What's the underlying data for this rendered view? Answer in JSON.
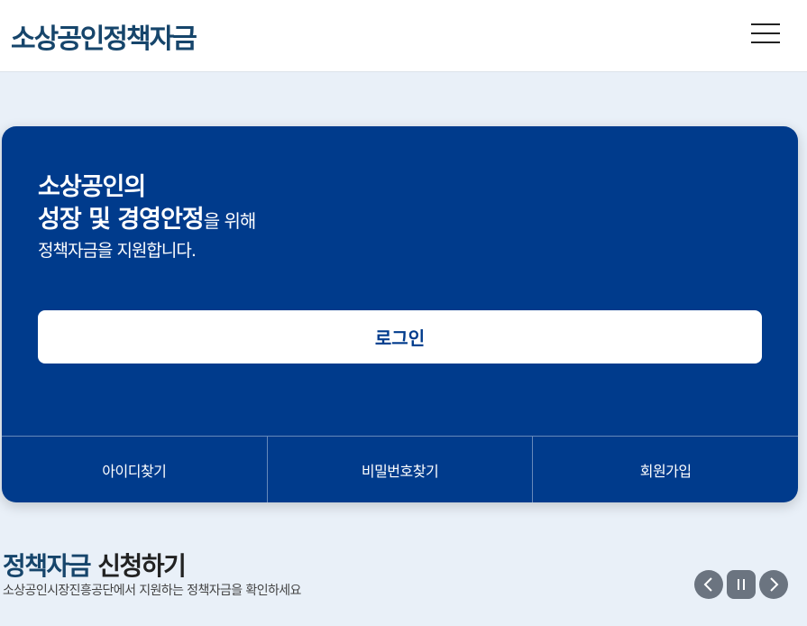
{
  "header": {
    "logo": "소상공인정책자금",
    "menu_icon": "hamburger-menu-icon"
  },
  "hero": {
    "line1": "소상공인의",
    "line2_bold": "성장 및 경영안정",
    "line2_rest": "을 위해",
    "line3": "정책자금을 지원합니다.",
    "login_label": "로그인"
  },
  "links": {
    "find_id": "아이디찾기",
    "find_password": "비밀번호찾기",
    "signup": "회원가입"
  },
  "section": {
    "title_accent": "정책자금",
    "title_rest": " 신청하기",
    "description": "소상공인시장진흥공단에서 지원하는 정책자금을 확인하세요"
  },
  "carousel_controls": {
    "prev_icon": "chevron-left-icon",
    "pause_icon": "pause-icon",
    "next_icon": "chevron-right-icon"
  },
  "colors": {
    "primary": "#003b8c",
    "logo": "#16456b",
    "background": "#e9f0f8",
    "control": "#6b7480"
  }
}
